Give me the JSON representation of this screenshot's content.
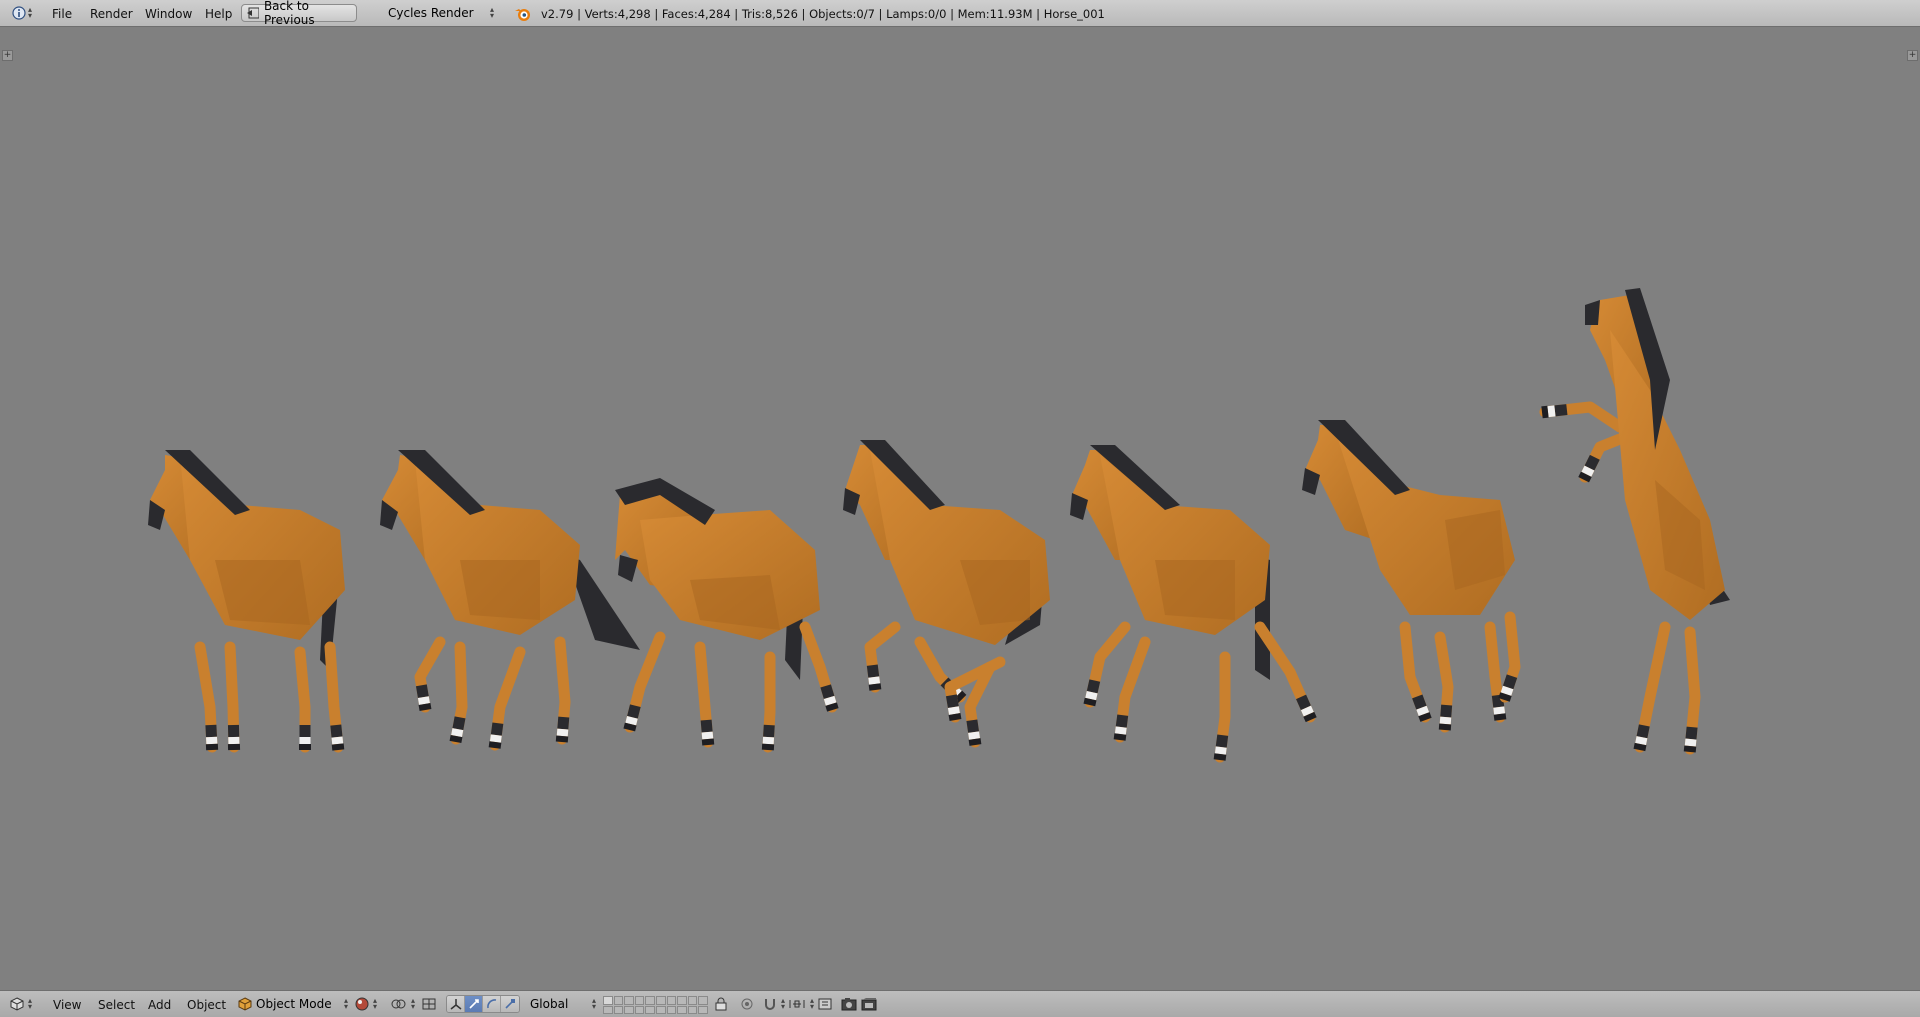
{
  "header": {
    "menus": [
      "File",
      "Render",
      "Window",
      "Help"
    ],
    "back_button": "Back to Previous",
    "render_engine": "Cycles Render",
    "stats": "v2.79 | Verts:4,298 | Faces:4,284 | Tris:8,526 | Objects:0/7 | Lamps:0/0 | Mem:11.93M | Horse_001"
  },
  "viewport": {
    "horse_color": "#c9802e",
    "mane_color": "#2a2a2e",
    "hoof_white": "#f0f0f0",
    "background": "#808080"
  },
  "footer": {
    "menus": [
      "View",
      "Select",
      "Add",
      "Object"
    ],
    "mode": "Object Mode",
    "orientation": "Global",
    "icons": [
      "cube-icon",
      "shading-sphere-icon",
      "pivot-icon",
      "manipulator-translate-icon",
      "manipulator-rotate-icon",
      "manipulator-scale-icon",
      "lock-icon",
      "render-still-icon",
      "render-anim-icon"
    ]
  },
  "colors": {
    "header_bg": "#c4c4c4",
    "active_tool": "#5b7bb3"
  }
}
